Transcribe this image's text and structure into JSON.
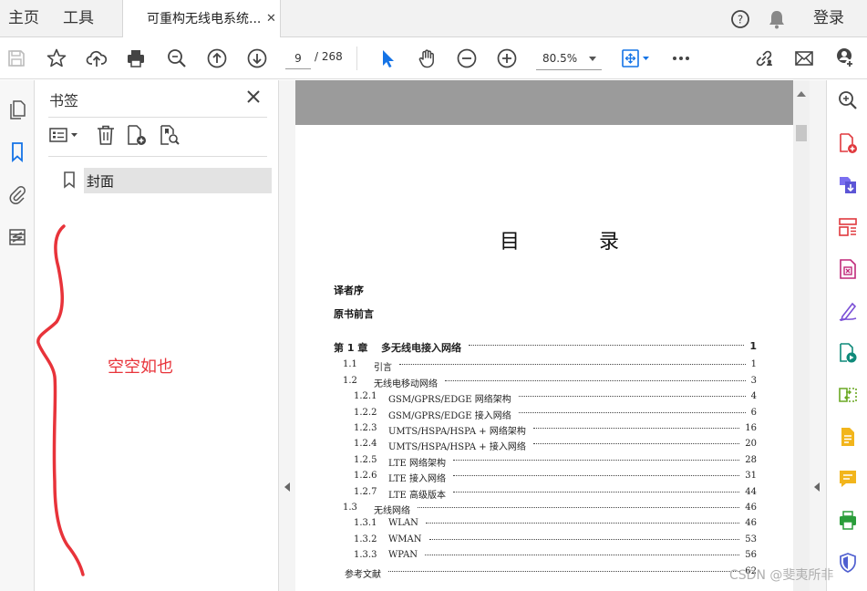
{
  "tabbar": {
    "home": "主页",
    "tools": "工具",
    "doc_tab_title": "可重构无线电系统...",
    "login": "登录"
  },
  "toolbar": {
    "page_current": "9",
    "page_total": "/ 268",
    "zoom": "80.5%"
  },
  "bookmarks": {
    "title": "书签",
    "items": [
      "封面"
    ]
  },
  "annotation": {
    "empty_note": "空空如也"
  },
  "toc": {
    "title": "目 录",
    "front": [
      "译者序",
      "原书前言"
    ],
    "rows": [
      {
        "no": "第 1 章",
        "label": "多无线电接入网络",
        "page": "1",
        "level": 0
      },
      {
        "no": "1.1",
        "label": "引言",
        "page": "1",
        "level": 1
      },
      {
        "no": "1.2",
        "label": "无线电移动网络",
        "page": "3",
        "level": 1
      },
      {
        "no": "1.2.1",
        "label": "GSM/GPRS/EDGE 网络架构",
        "page": "4",
        "level": 2
      },
      {
        "no": "1.2.2",
        "label": "GSM/GPRS/EDGE 接入网络",
        "page": "6",
        "level": 2
      },
      {
        "no": "1.2.3",
        "label": "UMTS/HSPA/HSPA + 网络架构",
        "page": "16",
        "level": 2
      },
      {
        "no": "1.2.4",
        "label": "UMTS/HSPA/HSPA + 接入网络",
        "page": "20",
        "level": 2
      },
      {
        "no": "1.2.5",
        "label": "LTE 网络架构",
        "page": "28",
        "level": 2
      },
      {
        "no": "1.2.6",
        "label": "LTE 接入网络",
        "page": "31",
        "level": 2
      },
      {
        "no": "1.2.7",
        "label": "LTE 高级版本",
        "page": "44",
        "level": 2
      },
      {
        "no": "1.3",
        "label": "无线网络",
        "page": "46",
        "level": 1
      },
      {
        "no": "1.3.1",
        "label": "WLAN",
        "page": "46",
        "level": 2
      },
      {
        "no": "1.3.2",
        "label": "WMAN",
        "page": "53",
        "level": 2
      },
      {
        "no": "1.3.3",
        "label": "WPAN",
        "page": "56",
        "level": 2
      },
      {
        "no": "",
        "label": "参考文献",
        "page": "62",
        "level": 1
      }
    ]
  },
  "watermark": "CSDN @斐夷所非",
  "colors": {
    "accent_blue": "#1473e6",
    "annotation_red": "#e8333a"
  },
  "icons": {
    "left_rail": [
      "pages-icon",
      "bookmark-icon",
      "attachment-icon",
      "layers-icon"
    ],
    "right_rail": [
      "enhance-scan-icon",
      "create-pdf-icon",
      "export-pdf-icon",
      "organize-pages-icon",
      "edit-pdf-icon",
      "fill-sign-icon",
      "send-track-icon",
      "compare-icon",
      "comment-icon",
      "sticky-note-icon",
      "print-production-icon",
      "protect-icon"
    ]
  }
}
